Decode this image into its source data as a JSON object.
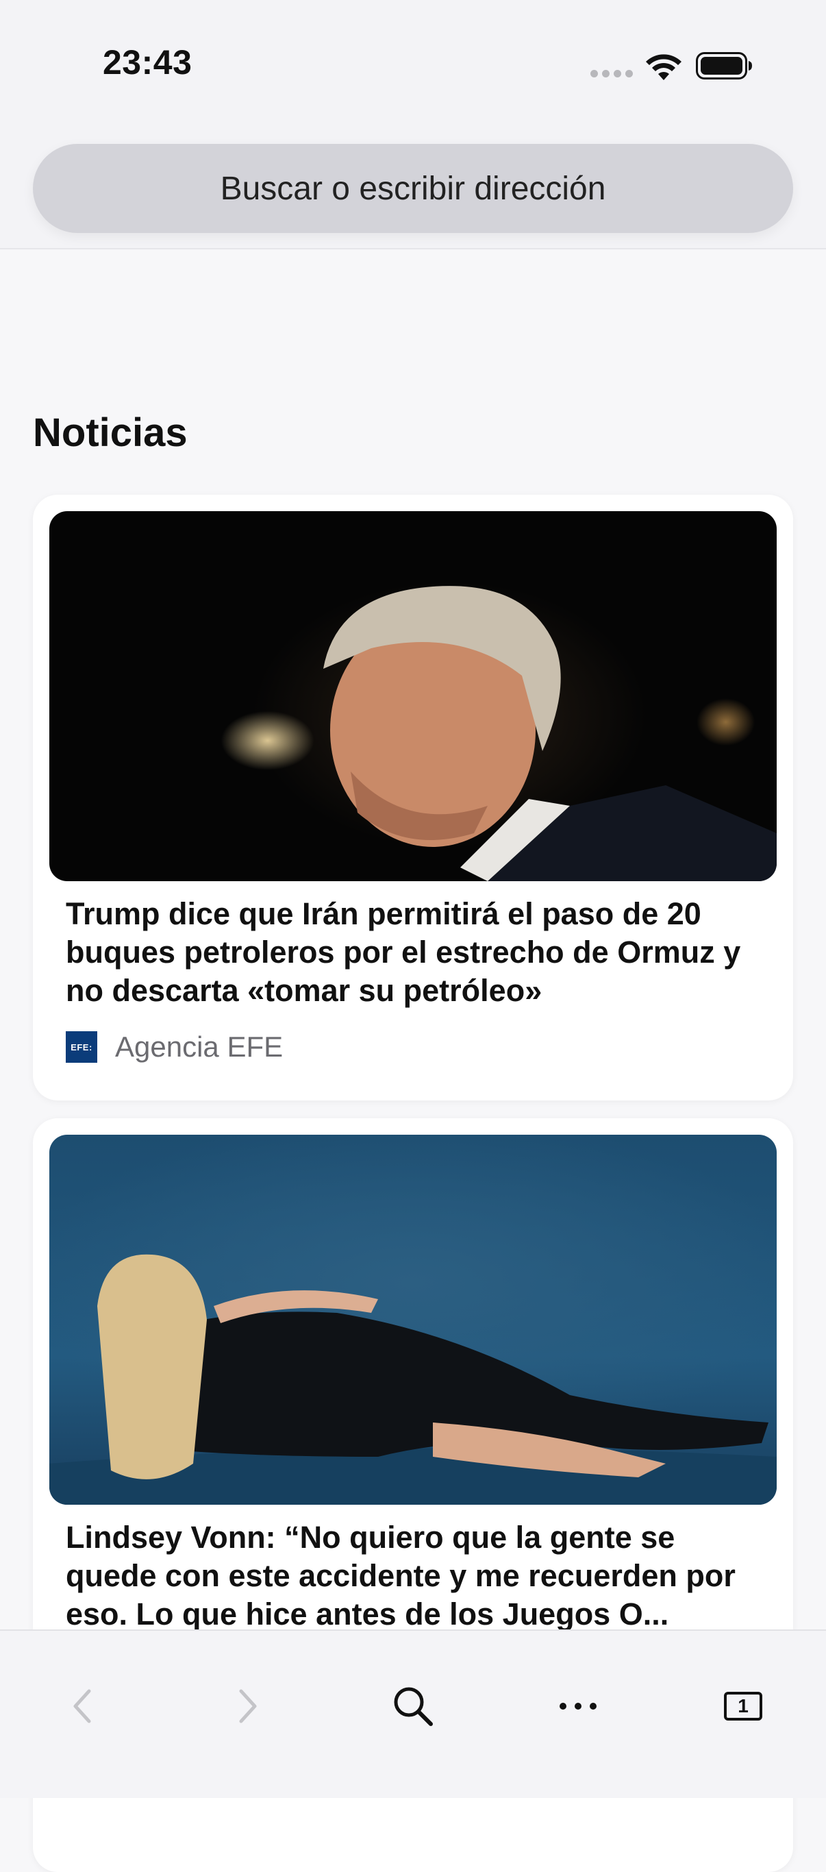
{
  "status_bar": {
    "time": "23:43"
  },
  "search": {
    "placeholder": "Buscar o escribir dirección"
  },
  "news": {
    "section_title": "Noticias",
    "articles": [
      {
        "title": "Trump dice que Irán permitirá el paso de 20 buques petroleros por el estrecho de Ormuz y no descarta «tomar su petróleo»",
        "source": "Agencia EFE",
        "source_logo_text": "EFE:"
      },
      {
        "title": "Lindsey Vonn: “No quiero que la gente se quede con este accidente y me recuerden por eso. Lo que hice antes de los Juegos O..."
      }
    ]
  },
  "toolbar": {
    "tab_count": "1"
  },
  "colors": {
    "background": "#f7f7f9",
    "search_bar": "#d3d3d9",
    "source_logo": "#0b3c7a"
  },
  "icons": [
    "back-icon",
    "forward-icon",
    "search-icon",
    "more-icon",
    "tabs-icon",
    "wifi-icon",
    "battery-icon",
    "cellular-signal-icon"
  ]
}
